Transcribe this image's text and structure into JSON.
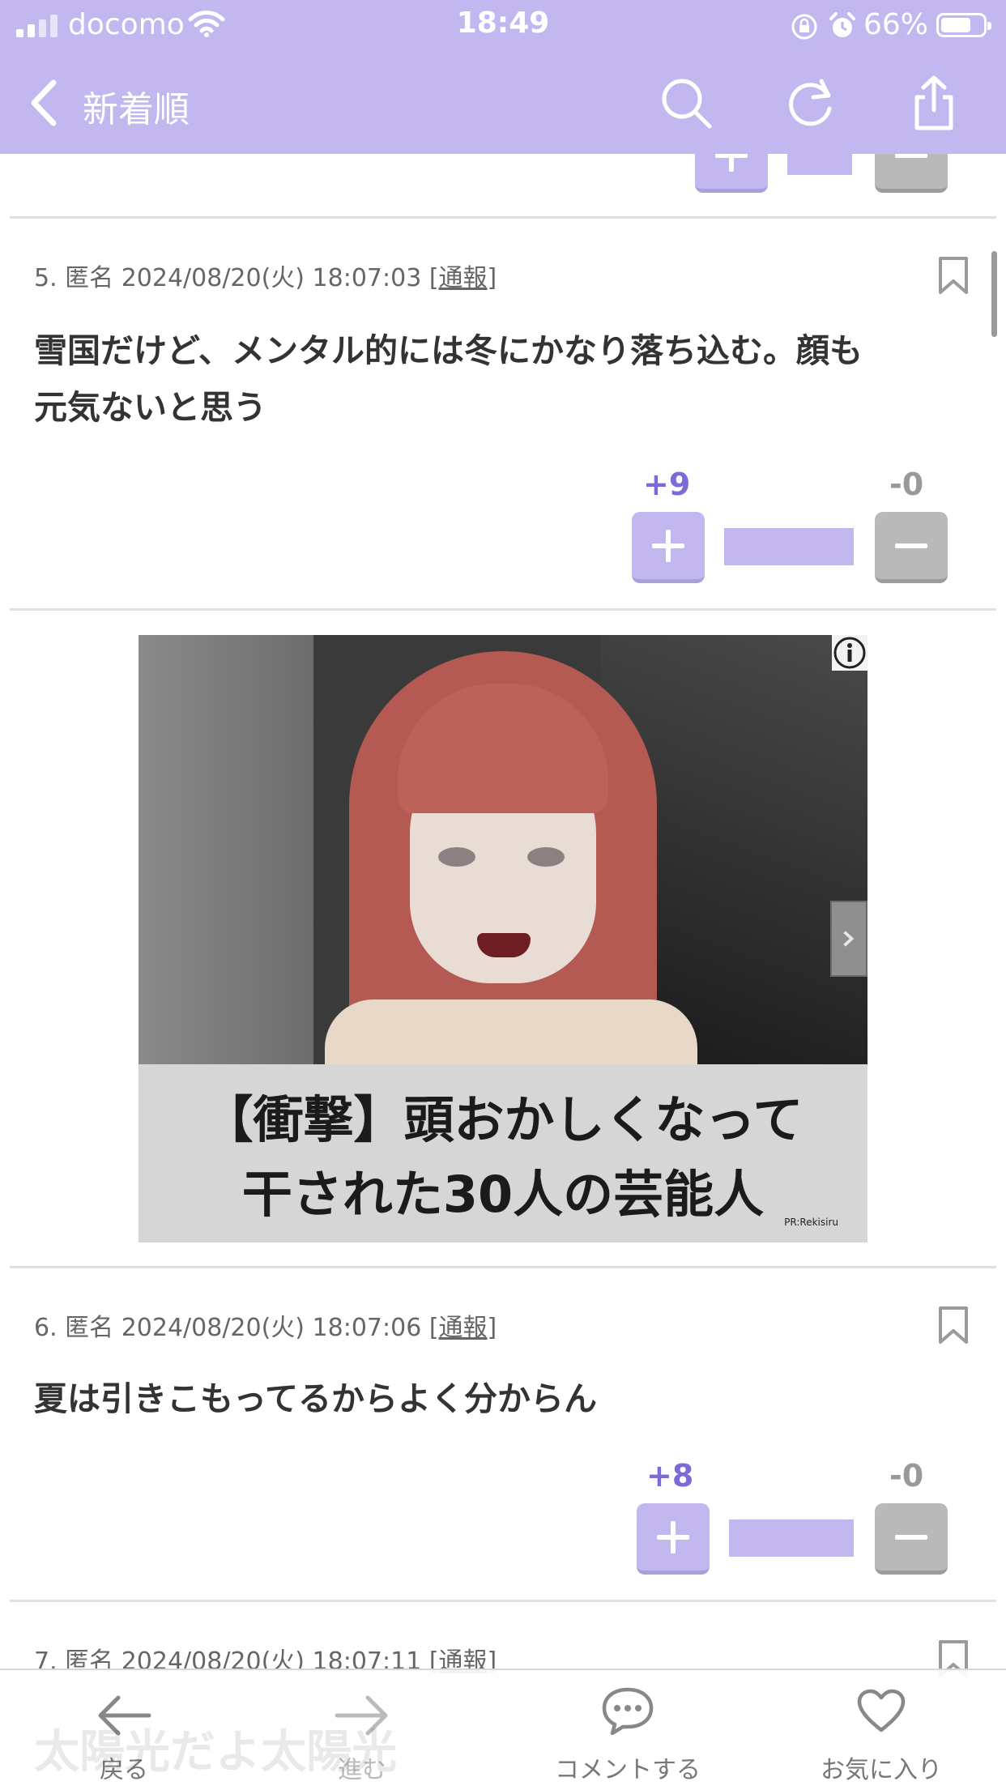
{
  "status_bar": {
    "carrier": "docomo",
    "time": "18:49",
    "battery_percent": "66%"
  },
  "nav": {
    "back_icon": "chevron-left-icon",
    "title": "新着順",
    "icons": [
      "search-icon",
      "refresh-icon",
      "share-icon"
    ]
  },
  "posts": [
    {
      "meta": "5. 匿名 2024/08/20(火) 18:07:03 [",
      "report": "通報",
      "meta_end": "]",
      "body_line1": "雪国だけど、メンタル的には冬にかなり落ち込む。顔も",
      "body_line2": "元気ないと思う",
      "plus": "+9",
      "minus": "-0",
      "plus_ratio": 1.0
    },
    {
      "meta": "6. 匿名 2024/08/20(火) 18:07:06 [",
      "report": "通報",
      "meta_end": "]",
      "body_line1": "夏は引きこもってるからよく分からん",
      "plus": "+8",
      "minus": "-0",
      "plus_ratio": 1.0
    },
    {
      "meta": "7. 匿名 2024/08/20(火) 18:07:11 [",
      "report": "通報",
      "meta_end": "]"
    }
  ],
  "ad": {
    "caption_line1": "【衝撃】頭おかしくなって",
    "caption_line2": "干された30人の芸能人",
    "pr_label": "PR:Rekisiru",
    "info_icon": "info-icon",
    "next_icon": "chevron-right-icon"
  },
  "toolbar": {
    "back_label": "戻る",
    "forward_label": "進む",
    "comment_label": "コメントする",
    "favorite_label": "お気に入り"
  },
  "ghost_text": "太陽光だよ太陽光",
  "colors": {
    "header": "#c2b8ef",
    "plus_count": "#7d69d8",
    "minus_button": "#b9b9b9"
  }
}
